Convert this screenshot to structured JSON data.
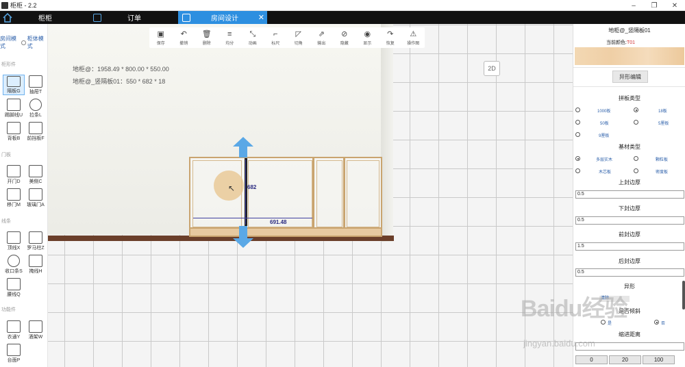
{
  "app": {
    "title": "柜柜 - 2.2",
    "window_controls": [
      "–",
      "❐",
      "✕"
    ]
  },
  "tabs": [
    {
      "label": "柜柜",
      "icon": "home-icon"
    },
    {
      "label": "订单",
      "icon": "list-icon"
    },
    {
      "label": "房间设计",
      "icon": "grid-icon",
      "active": true
    }
  ],
  "modes": {
    "room_mode": "房间模式",
    "cabinet_mode": "柜体模式"
  },
  "left_sections": {
    "s1": "柜形件",
    "s2": "门板",
    "s3": "线条",
    "s4": "功能件"
  },
  "left_tools": [
    {
      "label": "隔板G",
      "selected": true
    },
    {
      "label": "抽屉T"
    },
    {
      "label": "踢脚线U"
    },
    {
      "label": "拉条L"
    },
    {
      "label": "背板B"
    },
    {
      "label": "前挡板F"
    },
    {
      "label": "开门D"
    },
    {
      "label": "美侧C"
    },
    {
      "label": "移门M"
    },
    {
      "label": "玻璃门A"
    },
    {
      "label": "顶线X"
    },
    {
      "label": "罗马柱Z"
    },
    {
      "label": "收口条S"
    },
    {
      "label": "掩线H"
    },
    {
      "label": "腰线Q"
    },
    {
      "label": "衣通Y"
    },
    {
      "label": "酒架W"
    },
    {
      "label": "台面P"
    }
  ],
  "toolbar": [
    {
      "label": "保存",
      "icon": "▣"
    },
    {
      "label": "撤销",
      "icon": "↶"
    },
    {
      "label": "删除",
      "icon": "🗑"
    },
    {
      "label": "均分",
      "icon": "≡"
    },
    {
      "label": "动画",
      "icon": "⤡"
    },
    {
      "label": "标尺",
      "icon": "⌐"
    },
    {
      "label": "切角",
      "icon": "◸"
    },
    {
      "label": "输出",
      "icon": "⇗"
    },
    {
      "label": "隐藏",
      "icon": "⊘"
    },
    {
      "label": "显示",
      "icon": "◉"
    },
    {
      "label": "恢复",
      "icon": "↷"
    },
    {
      "label": "操作图",
      "icon": "⚠"
    }
  ],
  "canvas": {
    "info1": "地柜@：1958.49 * 800.00 * 550.00",
    "info2": "地柜@_竖隔板01：550 * 682 * 18",
    "view_toggle": "2D",
    "dim_width": "691.48",
    "dim_height": "682"
  },
  "props": {
    "title": "地柜@_竖隔板01",
    "color_label": "当前颜色:",
    "color_value": "T01",
    "shape_edit": "异形编辑",
    "board_type_h": "拼板类型",
    "board_types": [
      {
        "label": "1000板",
        "checked": false
      },
      {
        "label": "18板",
        "checked": true
      },
      {
        "label": "50板",
        "checked": false
      },
      {
        "label": "5厘板",
        "checked": false
      },
      {
        "label": "9厘板",
        "checked": false
      }
    ],
    "material_h": "基材类型",
    "materials": [
      {
        "label": "多层实木",
        "checked": true
      },
      {
        "label": "颗粒板",
        "checked": false
      },
      {
        "label": "木芯板",
        "checked": false
      },
      {
        "label": "密度板",
        "checked": false
      }
    ],
    "top_edge_h": "上封边厚",
    "top_edge": "0.5",
    "bottom_edge_h": "下封边厚",
    "bottom_edge": "0.5",
    "front_edge_h": "前封边厚",
    "front_edge": "1.5",
    "back_edge_h": "后封边厚",
    "back_edge": "0.5",
    "shape_h": "异形",
    "clear": "清除",
    "tilt_h": "是否倾斜",
    "tilt_yes": "是",
    "tilt_no": "否",
    "indent_h": "缩进距离",
    "indent": "",
    "presets": [
      "0",
      "20",
      "100"
    ]
  },
  "watermark": {
    "main": "Baidu经验",
    "sub": "jingyan.baidu.com"
  }
}
